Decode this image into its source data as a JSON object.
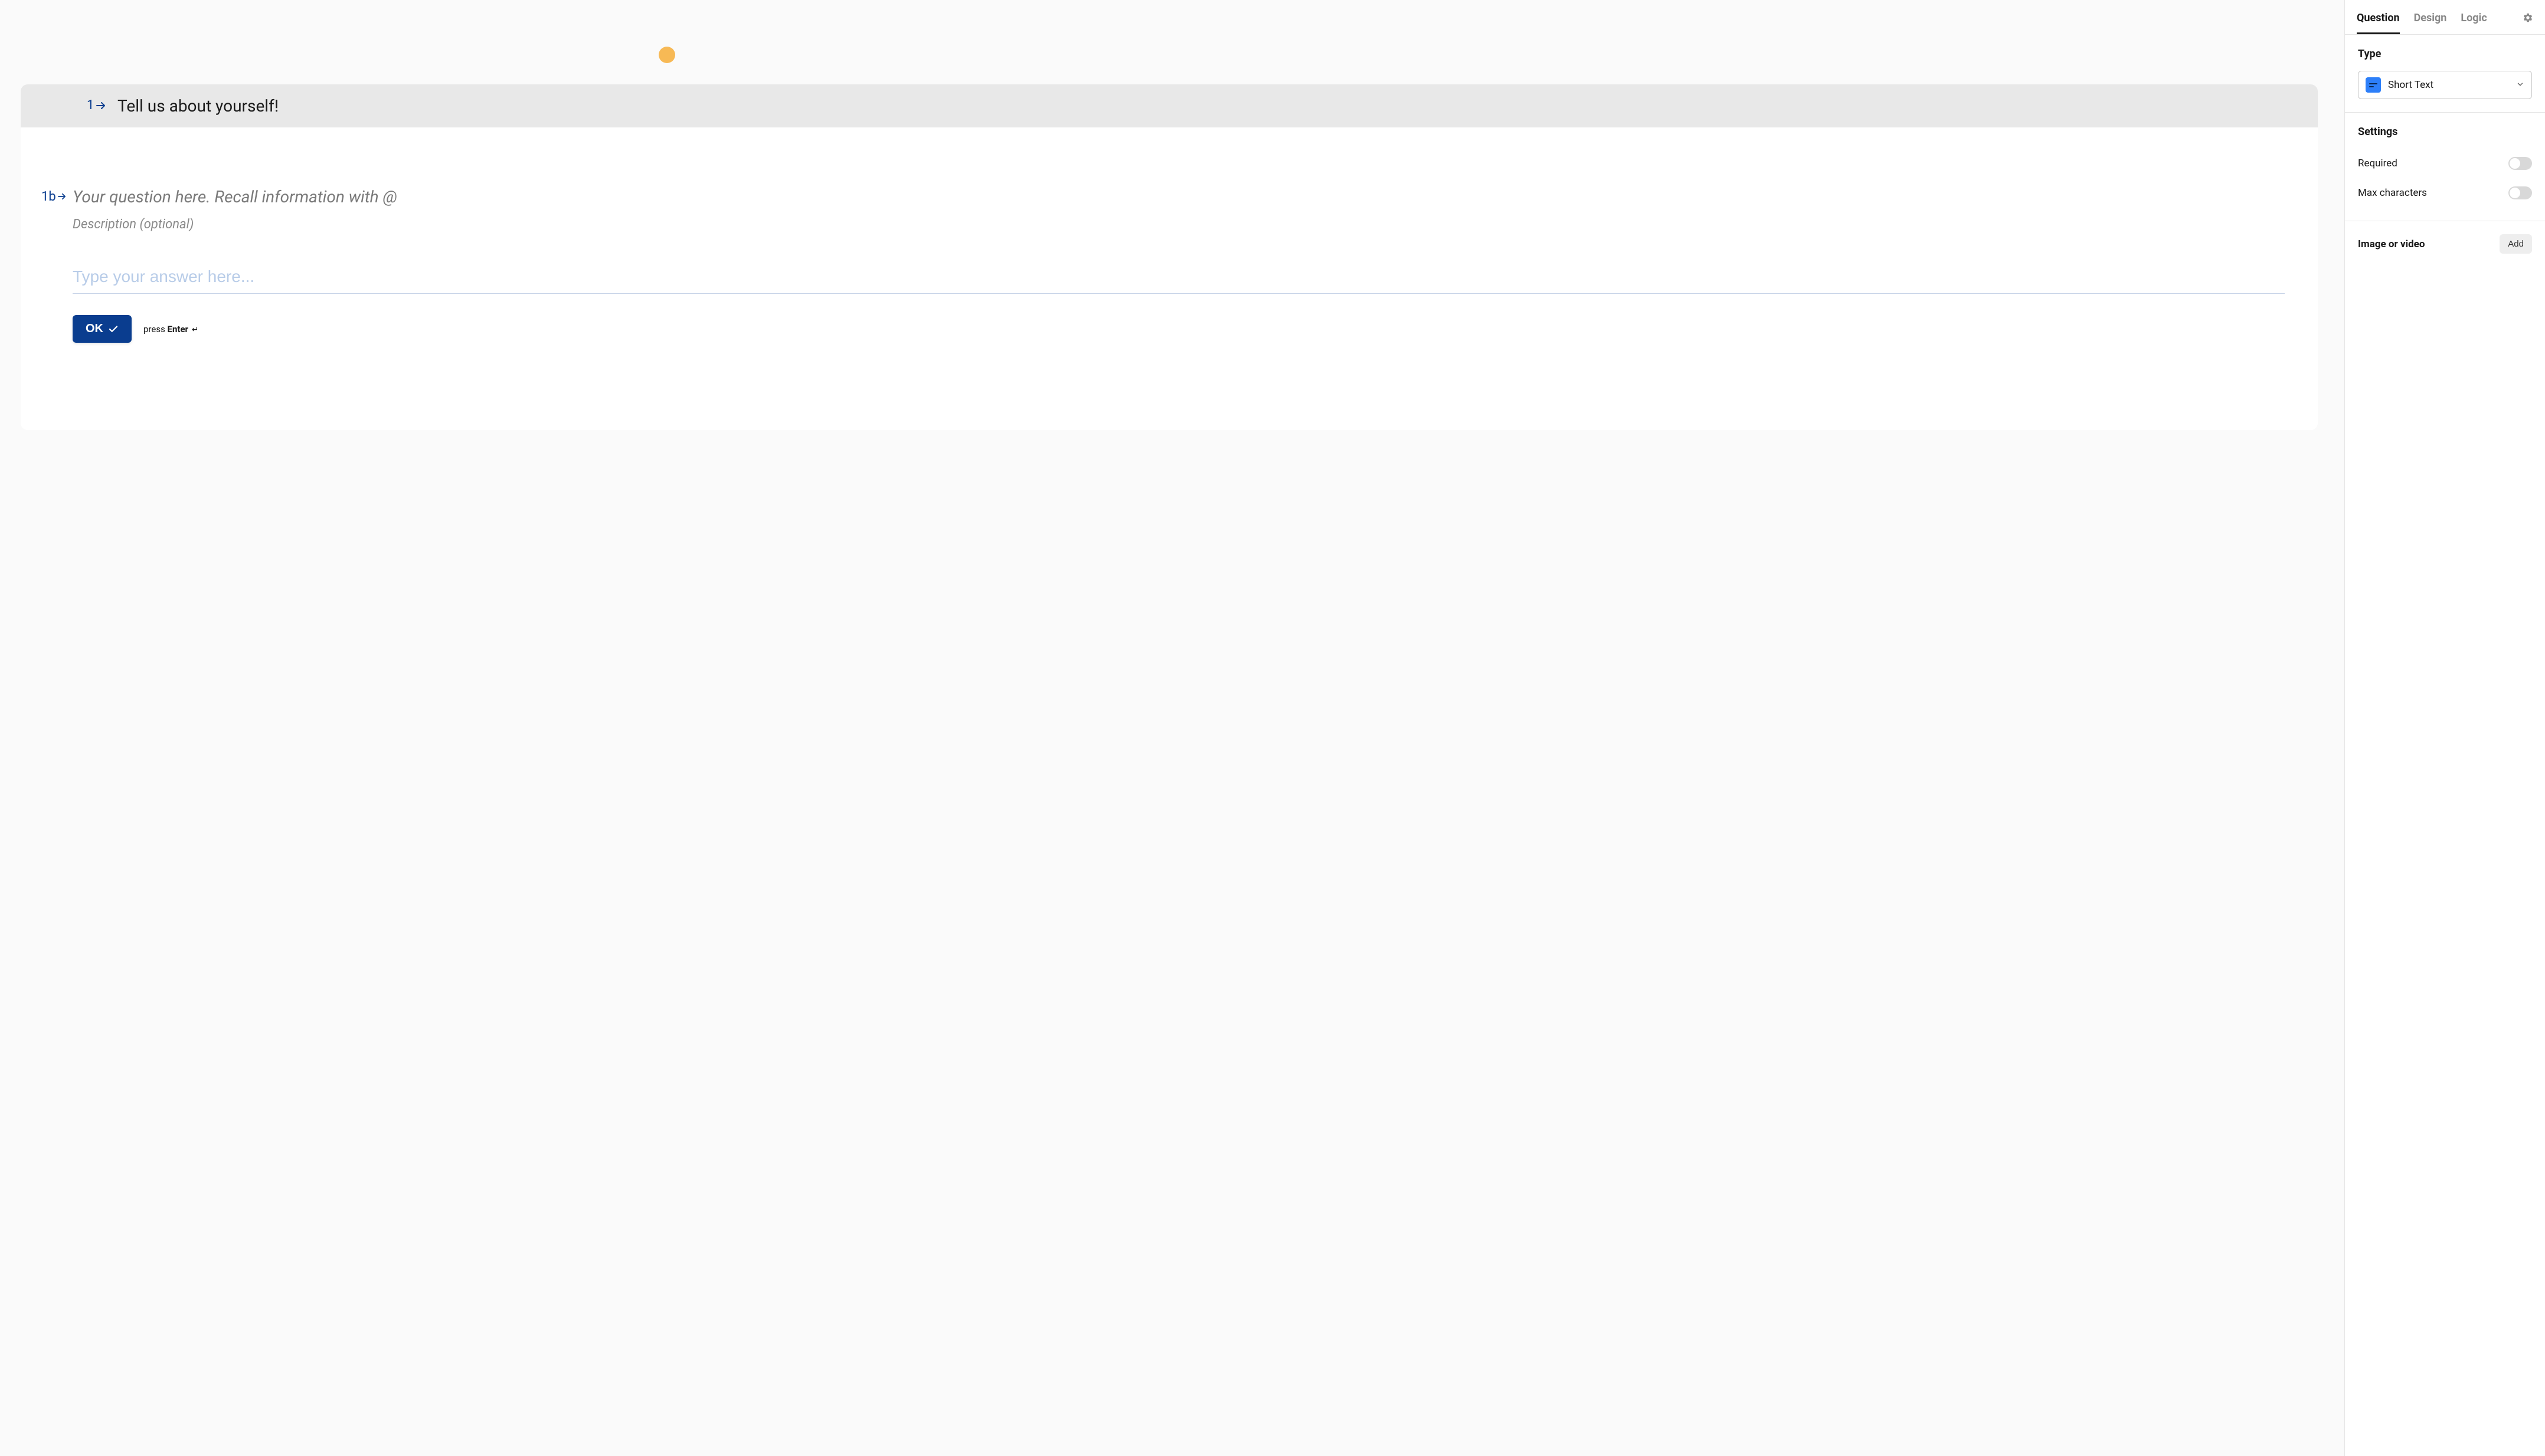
{
  "canvas": {
    "group": {
      "number": "1",
      "title": "Tell us about yourself!"
    },
    "question": {
      "indicator": "1b",
      "title_placeholder": "Your question here. Recall information with @",
      "description_placeholder": "Description (optional)",
      "answer_placeholder": "Type your answer here...",
      "ok_label": "OK",
      "press_label": "press ",
      "press_key": "Enter",
      "enter_symbol": "↵"
    }
  },
  "sidebar": {
    "tabs": {
      "question": "Question",
      "design": "Design",
      "logic": "Logic"
    },
    "type": {
      "label": "Type",
      "selected": "Short Text"
    },
    "settings": {
      "label": "Settings",
      "required": "Required",
      "max_chars": "Max characters"
    },
    "media": {
      "label": "Image or video",
      "add_label": "Add"
    }
  }
}
